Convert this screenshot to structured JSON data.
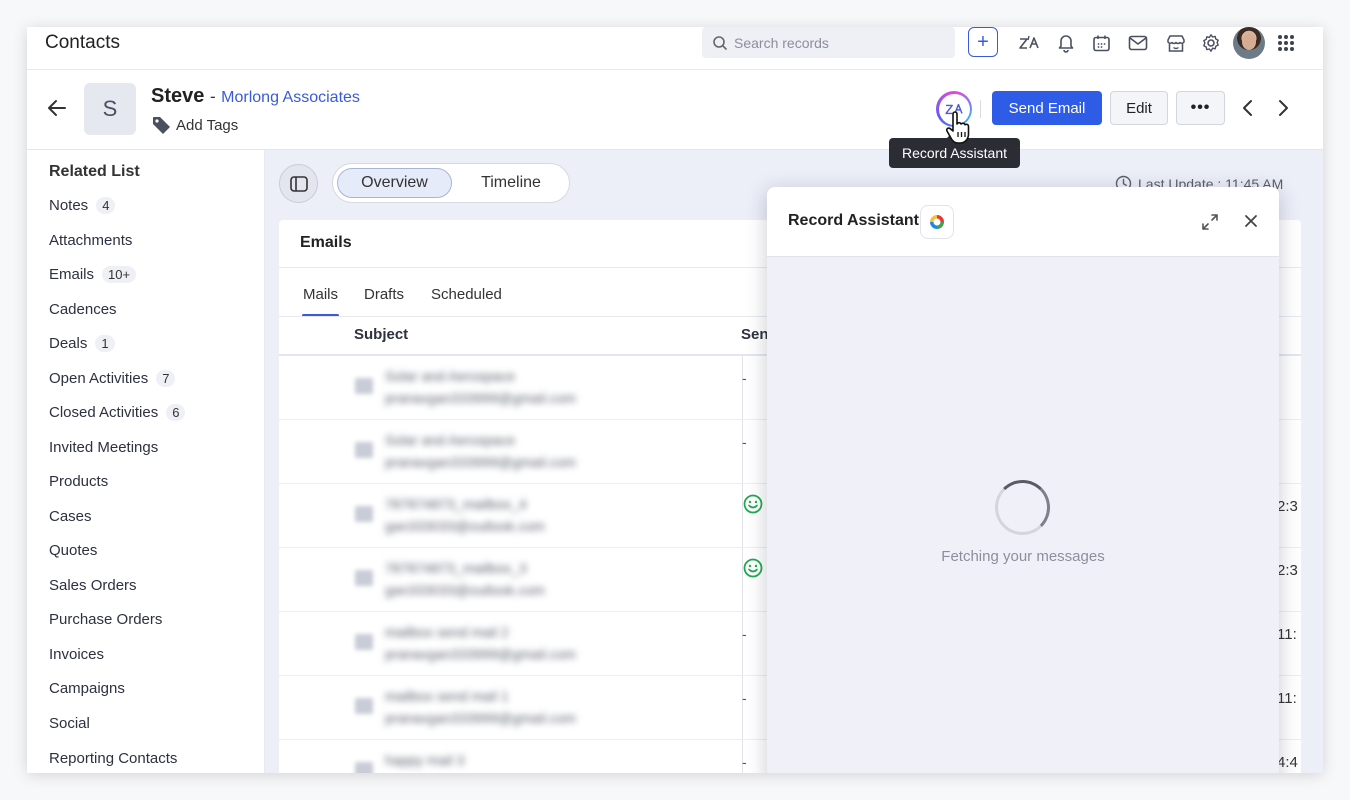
{
  "topbar": {
    "module_title": "Contacts",
    "search_placeholder": "Search records",
    "icons": [
      "search-icon",
      "plus-icon",
      "zia-icon",
      "bell-icon",
      "calendar-icon",
      "mail-icon",
      "store-icon",
      "gear-icon",
      "avatar",
      "grid-icon"
    ]
  },
  "record": {
    "initial": "S",
    "name": "Steve",
    "separator": "-",
    "company": "Morlong Associates",
    "add_tags": "Add Tags",
    "send_email": "Send Email",
    "edit": "Edit",
    "more": "•••",
    "tooltip": "Record Assistant"
  },
  "sidebar": {
    "title": "Related List",
    "items": [
      {
        "label": "Notes",
        "badge": "4"
      },
      {
        "label": "Attachments",
        "badge": ""
      },
      {
        "label": "Emails",
        "badge": "10+"
      },
      {
        "label": "Cadences",
        "badge": ""
      },
      {
        "label": "Deals",
        "badge": "1"
      },
      {
        "label": "Open Activities",
        "badge": "7"
      },
      {
        "label": "Closed Activities",
        "badge": "6"
      },
      {
        "label": "Invited Meetings",
        "badge": ""
      },
      {
        "label": "Products",
        "badge": ""
      },
      {
        "label": "Cases",
        "badge": ""
      },
      {
        "label": "Quotes",
        "badge": ""
      },
      {
        "label": "Sales Orders",
        "badge": ""
      },
      {
        "label": "Purchase Orders",
        "badge": ""
      },
      {
        "label": "Invoices",
        "badge": ""
      },
      {
        "label": "Campaigns",
        "badge": ""
      },
      {
        "label": "Social",
        "badge": ""
      },
      {
        "label": "Reporting Contacts",
        "badge": ""
      }
    ]
  },
  "main": {
    "tabs": [
      "Overview",
      "Timeline"
    ],
    "active_tab": "Overview",
    "last_update": "Last Update : 11:45 AM"
  },
  "emails": {
    "title": "Emails",
    "tabs": [
      "Mails",
      "Drafts",
      "Scheduled"
    ],
    "active_tab": "Mails",
    "columns": [
      "Subject",
      "Sen"
    ],
    "rows": [
      {
        "subject": "Solar and Aerospace",
        "address": "pranavgan333999@gmail.com",
        "sender": "-",
        "time": ""
      },
      {
        "subject": "Solar and Aerospace",
        "address": "pranavgan333999@gmail.com",
        "sender": "-",
        "time": ""
      },
      {
        "subject": "787874873_mailbox_4",
        "address": "gan333033@outlook.com",
        "sender": "smile",
        "time": "2:3"
      },
      {
        "subject": "787874873_mailbox_3",
        "address": "gan333033@outlook.com",
        "sender": "smile",
        "time": "2:3"
      },
      {
        "subject": "mailbox send mail 2",
        "address": "pranavgan333999@gmail.com",
        "sender": "-",
        "time": "11:"
      },
      {
        "subject": "mailbox send mail 1",
        "address": "pranavgan333999@gmail.com",
        "sender": "-",
        "time": "11:"
      },
      {
        "subject": "happy mail 3",
        "address": "",
        "sender": "-",
        "time": "4:4"
      }
    ]
  },
  "assistant": {
    "title": "Record Assistant",
    "status": "Fetching your messages"
  },
  "colors": {
    "accent": "#2f5ce6",
    "link": "#3a5bd9",
    "main_bg": "#eceef8",
    "tooltip_bg": "#2b2d35",
    "smile_green": "#1fa84f"
  }
}
